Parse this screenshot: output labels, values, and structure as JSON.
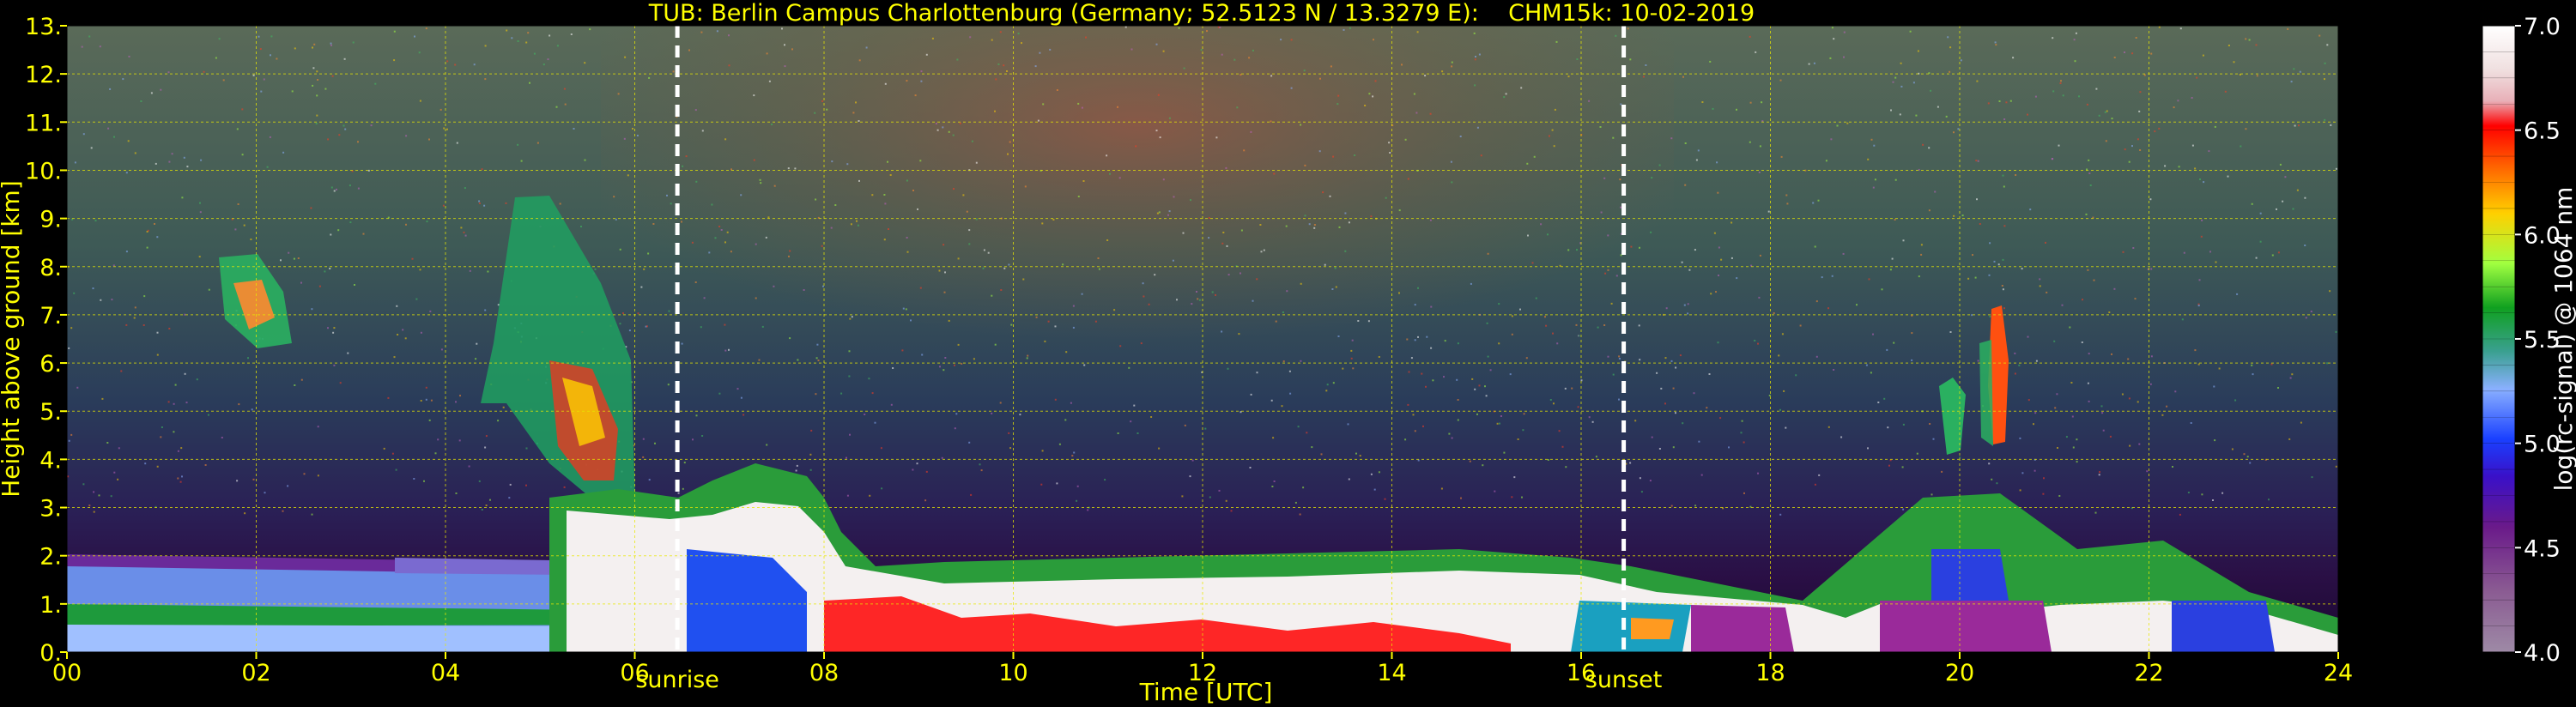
{
  "chart_data": {
    "type": "heatmap",
    "title": "TUB: Berlin Campus Charlottenburg (Germany; 52.5123 N / 13.3279 E):    CHM15k: 10-02-2019",
    "xlabel": "Time [UTC]",
    "ylabel": "Height above ground [km]",
    "xlim": [
      0,
      24
    ],
    "ylim": [
      0,
      13
    ],
    "x_ticks": [
      "00",
      "02",
      "04",
      "06",
      "08",
      "10",
      "12",
      "14",
      "16",
      "18",
      "20",
      "22",
      "24"
    ],
    "y_ticks": [
      "0.",
      "1.",
      "2.",
      "3.",
      "4.",
      "5.",
      "6.",
      "7.",
      "8.",
      "9.",
      "10.",
      "11.",
      "12.",
      "13."
    ],
    "grid": true,
    "markers": [
      {
        "label": "sunrise",
        "time": 6.45
      },
      {
        "label": "sunset",
        "time": 16.45
      }
    ],
    "colorbar": {
      "label": "log(rc-signal) @ 1064 nm",
      "min": 4.0,
      "max": 7.0,
      "ticks": [
        "4.0",
        "4.5",
        "5.0",
        "5.5",
        "6.0",
        "6.5",
        "7.0"
      ]
    },
    "features": [
      {
        "description": "boundary layer (log signal ~7)",
        "time_range": [
          6,
          24
        ],
        "height_range": [
          0,
          1.4
        ]
      },
      {
        "description": "lower aerosol layers",
        "time_range": [
          0,
          6.5
        ],
        "height_range": [
          0,
          2.1
        ]
      },
      {
        "description": "cirrus clouds",
        "time_range": [
          1.2,
          2.3
        ],
        "height_range": [
          6.4,
          8.3
        ]
      },
      {
        "description": "cirrus clouds",
        "time_range": [
          4.2,
          6
        ],
        "height_range": [
          3,
          9.5
        ]
      },
      {
        "description": "cloud",
        "time_range": [
          20.1,
          20.5
        ],
        "height_range": [
          4.2,
          6.8
        ]
      }
    ]
  },
  "colors": {
    "text": "#ffff00",
    "grid": "#e8e800",
    "background": "#000000",
    "marker": "#ffffff"
  }
}
